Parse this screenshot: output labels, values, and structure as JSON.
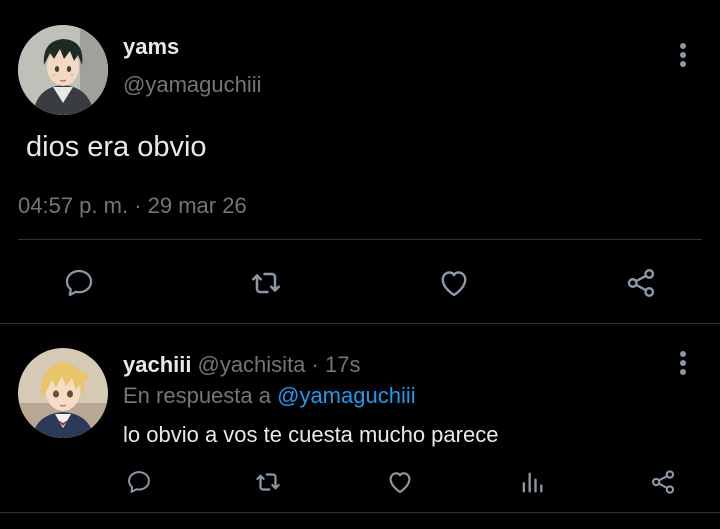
{
  "colors": {
    "background": "#000000",
    "text": "#e7e9ea",
    "muted": "#71767b",
    "link": "#1d9bf0",
    "divider": "#2f3336",
    "icon": "#8b98a5"
  },
  "main_tweet": {
    "display_name": "yams",
    "handle": "@yamaguchiii",
    "text": "dios era obvio",
    "time": "04:57 p. m.",
    "separator": " · ",
    "date": "29 mar 26",
    "avatar_icon": "avatar-yamaguchi",
    "actions": [
      "reply-icon",
      "retweet-icon",
      "like-icon",
      "share-icon"
    ]
  },
  "reply_tweet": {
    "display_name": "yachiii",
    "handle": "@yachisita",
    "separator": " · ",
    "age": "17s",
    "reply_prefix": "En respuesta a ",
    "reply_mention": "@yamaguchiii",
    "text": "lo obvio a vos te cuesta mucho parece",
    "avatar_icon": "avatar-yachi",
    "actions": [
      "reply-icon",
      "retweet-icon",
      "like-icon",
      "analytics-icon",
      "share-icon"
    ]
  }
}
